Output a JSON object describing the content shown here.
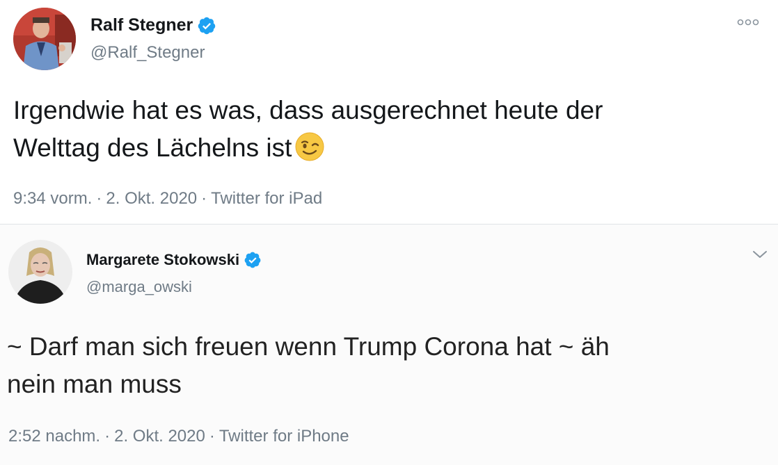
{
  "tweets": [
    {
      "display_name": "Ralf Stegner",
      "handle": "@Ralf_Stegner",
      "verified": true,
      "text_line1": "Irgendwie hat es was, dass ausgerechnet heute der",
      "text_line2": "Welttag des Lächelns ist",
      "emoji": "winking-face-emoji",
      "time": "9:34 vorm.",
      "date": "2. Okt. 2020",
      "source": "Twitter for iPad",
      "separator": "·",
      "action_icon": "more-options-icon"
    },
    {
      "display_name": "Margarete Stokowski",
      "handle": "@marga_owski",
      "verified": true,
      "text_line1": "~ Darf man sich freuen wenn Trump Corona hat ~ äh",
      "text_line2": "nein man muss",
      "time": "2:52 nachm.",
      "date": "2. Okt. 2020",
      "source": "Twitter for iPhone",
      "separator": "·",
      "action_icon": "chevron-down-icon"
    }
  ],
  "colors": {
    "verified_blue": "#1da1f2",
    "secondary_text": "#6f7b86",
    "primary_text": "#14171a",
    "divider": "#dfe3e6"
  }
}
